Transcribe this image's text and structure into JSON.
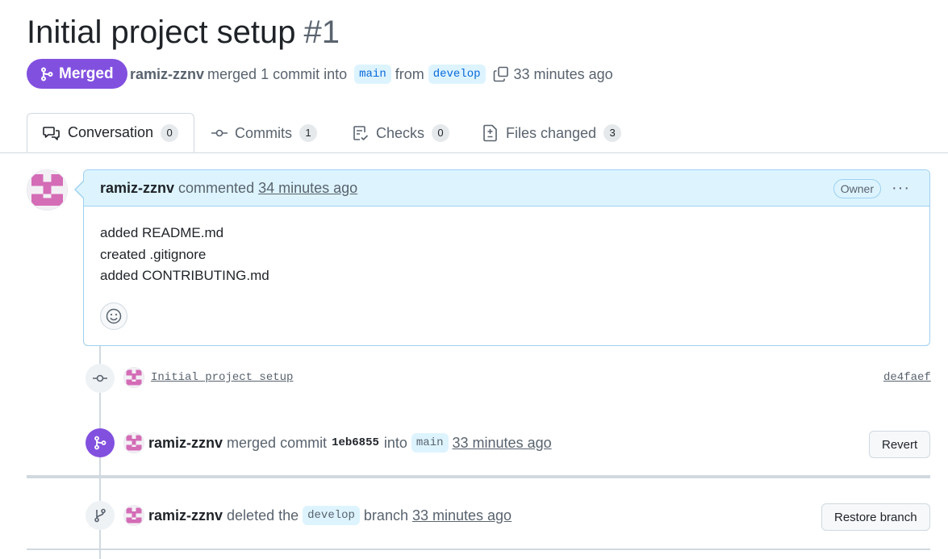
{
  "pr": {
    "title": "Initial project setup",
    "number": "#1",
    "state": "Merged",
    "author": "ramiz-zznv",
    "merge_text": "merged 1 commit into",
    "base_branch": "main",
    "from_text": "from",
    "head_branch": "develop",
    "merged_time": "33 minutes ago"
  },
  "tabs": [
    {
      "label": "Conversation",
      "count": "0",
      "icon": "comment-discussion-icon"
    },
    {
      "label": "Commits",
      "count": "1",
      "icon": "git-commit-icon"
    },
    {
      "label": "Checks",
      "count": "0",
      "icon": "checklist-icon"
    },
    {
      "label": "Files changed",
      "count": "3",
      "icon": "file-diff-icon"
    }
  ],
  "comment": {
    "author": "ramiz-zznv",
    "action": "commented",
    "time": "34 minutes ago",
    "role": "Owner",
    "menu": "···",
    "lines": [
      "added README.md",
      "created .gitignore",
      "added CONTRIBUTING.md"
    ]
  },
  "timeline": {
    "commit": {
      "message": "Initial project setup",
      "sha": "de4faef"
    },
    "merge": {
      "author": "ramiz-zznv",
      "text1": "merged commit",
      "sha": "1eb6855",
      "text2": "into",
      "branch": "main",
      "time": "33 minutes ago",
      "button": "Revert"
    },
    "delete": {
      "author": "ramiz-zznv",
      "text1": "deleted the",
      "branch": "develop",
      "text2": "branch",
      "time": "33 minutes ago",
      "button": "Restore branch"
    }
  },
  "colors": {
    "merged": "#8250df",
    "branch_bg": "#ddf4ff",
    "branch_fg": "#0969da",
    "comment_header": "#ddf4ff"
  }
}
